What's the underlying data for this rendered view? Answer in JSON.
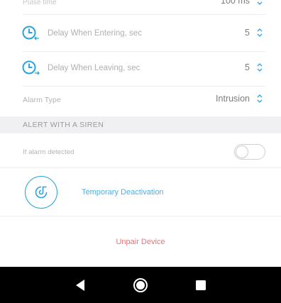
{
  "pulse": {
    "label": "Pulse time",
    "value": "100 ms"
  },
  "delay_enter": {
    "label": "Delay When Entering, sec",
    "value": "5"
  },
  "delay_leave": {
    "label": "Delay When Leaving, sec",
    "value": "5"
  },
  "alarm_type": {
    "label": "Alarm Type",
    "value": "Intrusion"
  },
  "siren_section": {
    "title": "ALERT WITH A SIREN"
  },
  "if_alarm": {
    "label": "If alarm detected",
    "toggle_on": false
  },
  "temporary_deactivation": {
    "label": "Temporary Deactivation"
  },
  "unpair": {
    "label": "Unpair Device"
  },
  "colors": {
    "accent": "#27a4de",
    "danger": "#e0787b",
    "section_bg": "#f0f0f2",
    "navbar": "#000000"
  },
  "icons": {
    "enter_icon": "clock-arrow-left-icon",
    "leave_icon": "clock-arrow-right-icon",
    "deactivation_icon": "deactivation-icon",
    "nav": [
      "back-icon",
      "home-icon",
      "recents-icon"
    ]
  }
}
